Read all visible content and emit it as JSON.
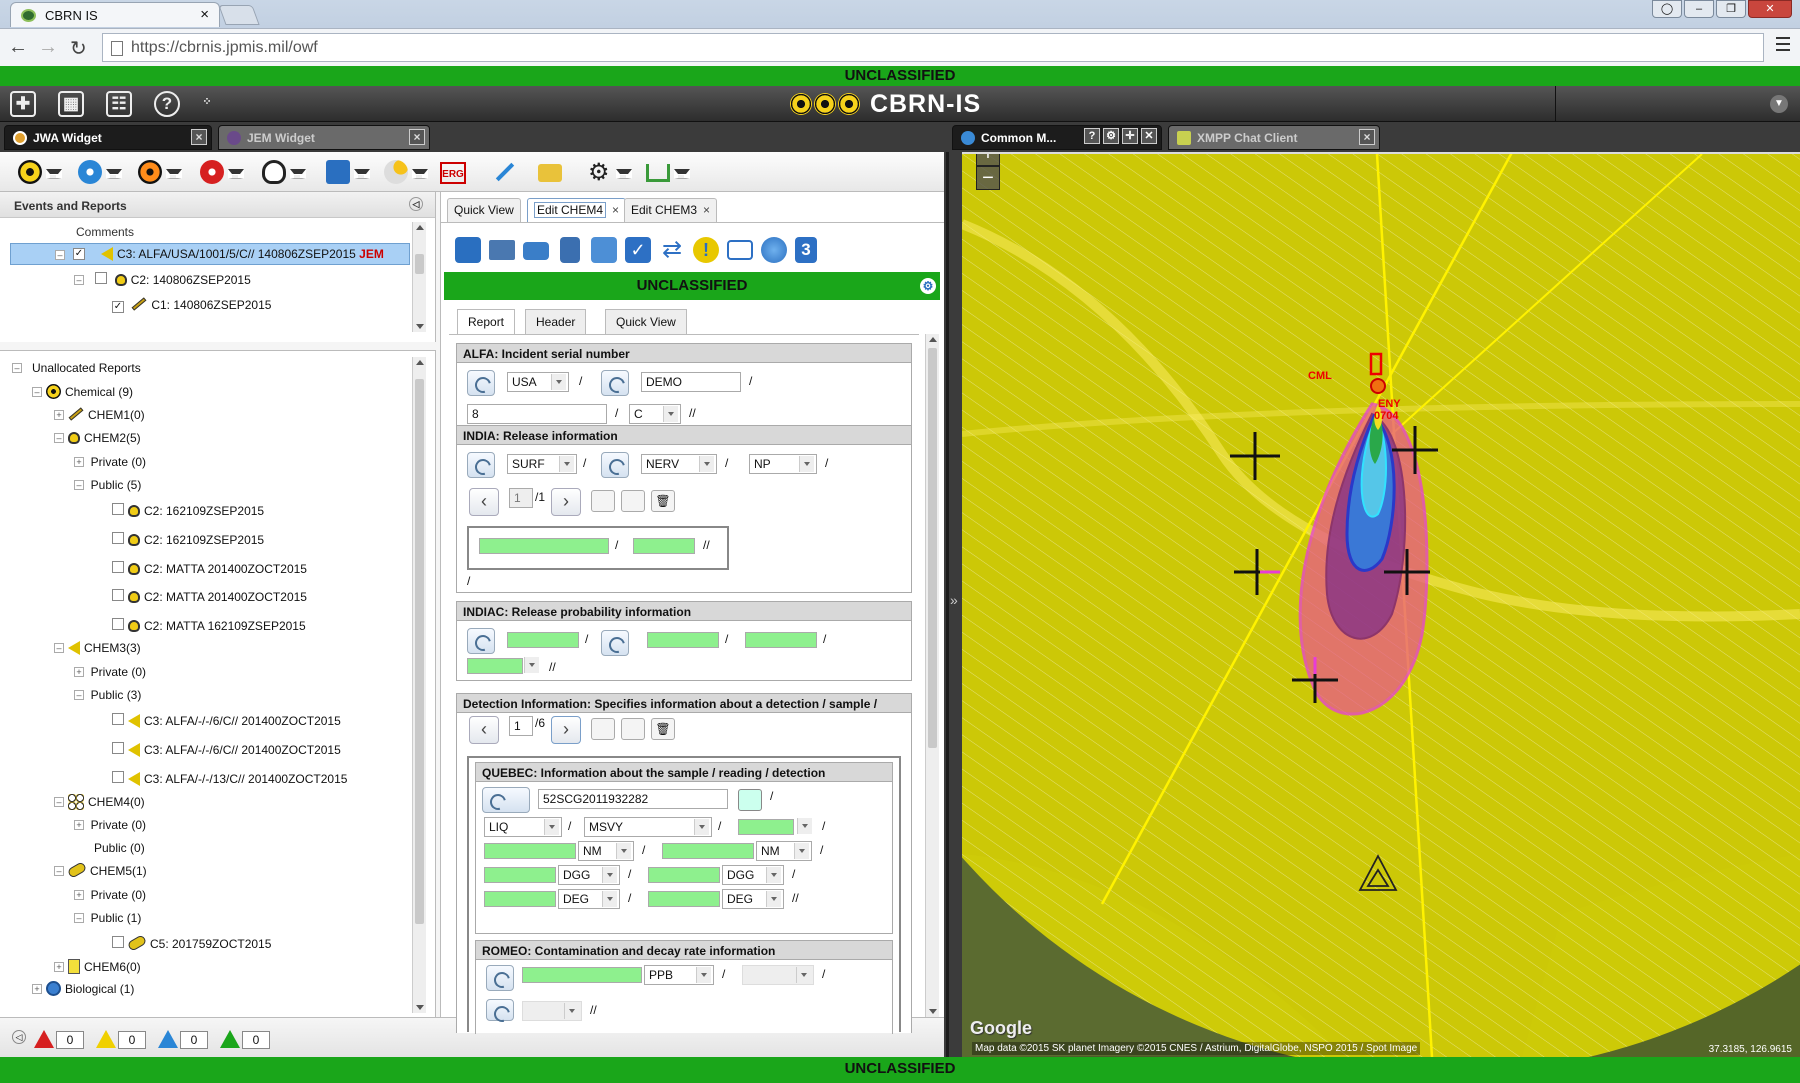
{
  "browser": {
    "tab_title": "CBRN IS",
    "url": "https://cbrnis.jpmis.mil/owf"
  },
  "classification": "UNCLASSIFIED",
  "app": {
    "title": "CBRN-IS",
    "header_icons": [
      "add-widget-icon",
      "dashboard-icon",
      "settings-icon",
      "help-icon"
    ]
  },
  "left_widgets": {
    "tabs": [
      {
        "label": "JWA Widget",
        "icon": "jwa-icon"
      },
      {
        "label": "JEM Widget",
        "icon": "jem-icon"
      }
    ],
    "toolbar_icons": [
      "chemical-icon",
      "biological-icon",
      "radiological-icon",
      "nuclear-icon",
      "anchor-icon",
      "report-icon",
      "weather-icon",
      "erg-icon",
      "survey-icon",
      "folder-icon",
      "gear-icon",
      "network-icon"
    ],
    "erg_label": "ERG"
  },
  "events": {
    "title": "Events and Reports",
    "column": "Comments",
    "rows": [
      {
        "label": "C3: ALFA/USA/1001/5/C// 140806ZSEP2015",
        "tag": "JEM"
      },
      {
        "label": "C2: 140806ZSEP2015"
      },
      {
        "label": "C1: 140806ZSEP2015"
      }
    ]
  },
  "unallocated": {
    "title": "Unallocated Reports",
    "chemical": "Chemical (9)",
    "chem1": "CHEM1(0)",
    "chem2": "CHEM2(5)",
    "chem2_private": "Private (0)",
    "chem2_public": "Public (5)",
    "chem2_items": [
      "C2: 162109ZSEP2015",
      "C2: 162109ZSEP2015",
      "C2: MATTA 201400ZOCT2015",
      "C2: MATTA 201400ZOCT2015",
      "C2: MATTA 162109ZSEP2015"
    ],
    "chem3": "CHEM3(3)",
    "chem3_private": "Private (0)",
    "chem3_public": "Public (3)",
    "chem3_items": [
      "C3: ALFA/-/-/6/C// 201400ZOCT2015",
      "C3: ALFA/-/-/6/C// 201400ZOCT2015",
      "C3: ALFA/-/-/13/C// 201400ZOCT2015"
    ],
    "chem4": "CHEM4(0)",
    "chem4_private": "Private (0)",
    "chem4_public": "Public (0)",
    "chem5": "CHEM5(1)",
    "chem5_private": "Private (0)",
    "chem5_public": "Public (1)",
    "chem5_items": [
      "C5: 201759ZOCT2015"
    ],
    "chem6": "CHEM6(0)",
    "biological": "Biological (1)"
  },
  "counters": [
    {
      "color": "#d62020",
      "value": "0"
    },
    {
      "color": "#f0d000",
      "value": "0"
    },
    {
      "color": "#2a86d6",
      "value": "0"
    },
    {
      "color": "#1aa61a",
      "value": "0"
    }
  ],
  "form": {
    "tabs": [
      {
        "label": "Quick View"
      },
      {
        "label": "Edit CHEM4"
      },
      {
        "label": "Edit CHEM3"
      }
    ],
    "toolbar_icons": [
      "save-icon",
      "print-icon",
      "email-icon",
      "delete-icon",
      "export-icon",
      "validate-icon",
      "refresh-icon",
      "alert-icon",
      "comment-icon",
      "globe-icon",
      "count-icon"
    ],
    "count_badge": "3",
    "classification": "UNCLASSIFIED",
    "subtabs": [
      "Report",
      "Header",
      "Quick View"
    ],
    "alfa": {
      "title": "ALFA: Incident serial number",
      "country": "USA",
      "org": "DEMO",
      "serial": "8",
      "type": "C",
      "sep1": "/",
      "sep2": "/",
      "sep3": "/",
      "end": "//"
    },
    "india": {
      "title": "INDIA: Release information",
      "release_type": "SURF",
      "agent": "NERV",
      "persistency": "NP",
      "page": "1",
      "page_total": "/1",
      "sep": "/",
      "end": "//"
    },
    "indiac": {
      "title": "INDIAC: Release probability information",
      "sep": "/",
      "end": "//"
    },
    "detection": {
      "title": "Detection Information: Specifies information about a detection / sample / reading",
      "page": "1",
      "page_total": "/6"
    },
    "quebec": {
      "title": "QUEBEC: Information about the sample / reading / detection",
      "sample_id": "52SCG2011932282",
      "state": "LIQ",
      "method": "MSVY",
      "unit_nm1": "NM",
      "unit_nm2": "NM",
      "unit_dgg1": "DGG",
      "unit_dgg2": "DGG",
      "unit_deg1": "DEG",
      "unit_deg2": "DEG",
      "sep": "/",
      "end": "//"
    },
    "romeo": {
      "title": "ROMEO: Contamination and decay rate information",
      "unit": "PPB",
      "sep": "/",
      "end": "//"
    }
  },
  "map_widgets": {
    "tabs": [
      {
        "label": "Common M..."
      },
      {
        "label": "XMPP Chat Client"
      }
    ]
  },
  "map": {
    "attribution": "Map data ©2015 SK planet Imagery ©2015 CNES / Astrium, DigitalGlobe, NSPO 2015 / Spot Image",
    "coordinates": "37.3185, 126.9615",
    "google_logo": "Google",
    "labels": [
      "CML",
      "ENY",
      "0704"
    ],
    "zoom_in": "+",
    "zoom_out": "−",
    "colors": {
      "hazard_area": "#d9d20a",
      "plume_outer": "#e83cd8",
      "plume_mid": "#8a2a8a",
      "plume_inner": "#2a39c9"
    }
  }
}
